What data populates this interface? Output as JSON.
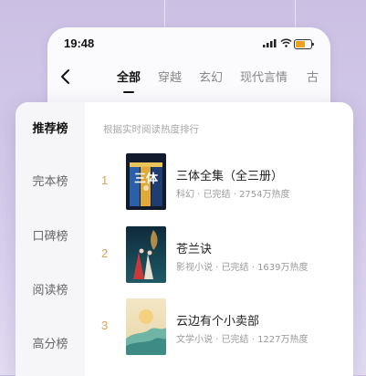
{
  "status_bar": {
    "time": "19:48"
  },
  "tabs": [
    {
      "label": "全部",
      "active": true
    },
    {
      "label": "穿越"
    },
    {
      "label": "玄幻"
    },
    {
      "label": "现代言情"
    },
    {
      "label": "古"
    }
  ],
  "sidebar": {
    "items": [
      {
        "label": "推荐榜",
        "active": true
      },
      {
        "label": "完本榜"
      },
      {
        "label": "口碑榜"
      },
      {
        "label": "阅读榜"
      },
      {
        "label": "高分榜"
      }
    ]
  },
  "list": {
    "subtitle": "根据实时阅读热度排行",
    "books": [
      {
        "rank": "1",
        "title": "三体全集（全三册）",
        "meta": "科幻 · 已完结 · 2754万热度",
        "cover_text": "三体"
      },
      {
        "rank": "2",
        "title": "苍兰诀",
        "meta": "影视小说 · 已完结 · 1639万热度"
      },
      {
        "rank": "3",
        "title": "云边有个小卖部",
        "meta": "文学小说 · 已完结 · 1227万热度"
      }
    ]
  },
  "colors": {
    "rank": "#d8a257",
    "accent_bg": "#cbc0e3"
  }
}
